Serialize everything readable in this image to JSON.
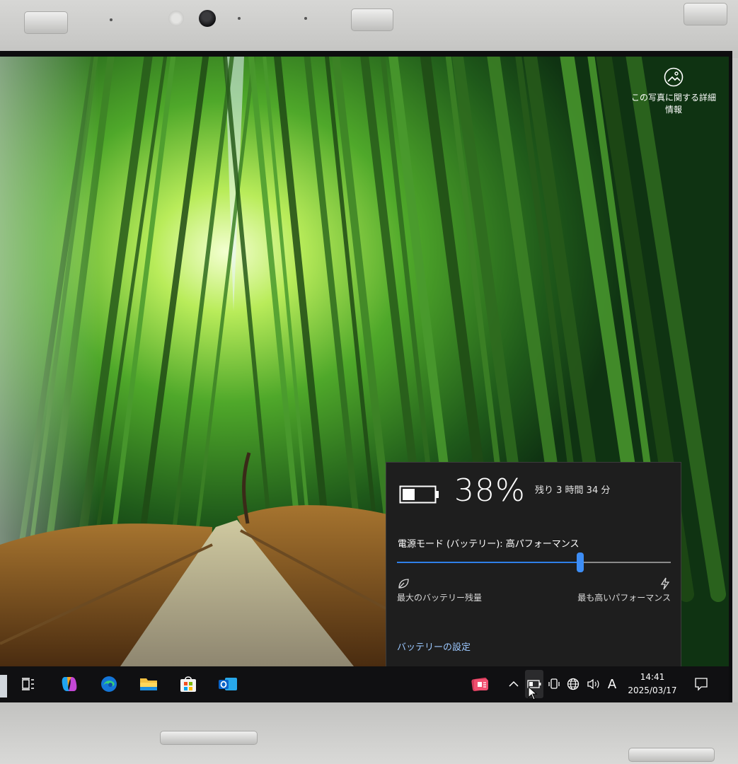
{
  "desktop": {
    "photo_info_label": "この写真に関する詳細情報"
  },
  "battery_flyout": {
    "percent": "38%",
    "remaining": "残り 3 時間 34 分",
    "power_mode_label": "電源モード (バッテリー): 高パフォーマンス",
    "slider_position_fraction": 0.67,
    "left_label": "最大のバッテリー残量",
    "right_label": "最も高いパフォーマンス",
    "settings_link": "バッテリーの設定",
    "accent_color": "#2f80e8",
    "background_color": "#1e1e1e"
  },
  "taskbar": {
    "pinned_apps": [
      {
        "icon": "task-view-icon"
      },
      {
        "icon": "copilot-icon"
      },
      {
        "icon": "edge-icon"
      },
      {
        "icon": "file-explorer-icon"
      },
      {
        "icon": "microsoft-store-icon"
      },
      {
        "icon": "outlook-icon"
      }
    ],
    "tray": {
      "chevron": "^",
      "ime_indicator": "A",
      "time": "14:41",
      "date": "2025/03/17"
    }
  }
}
